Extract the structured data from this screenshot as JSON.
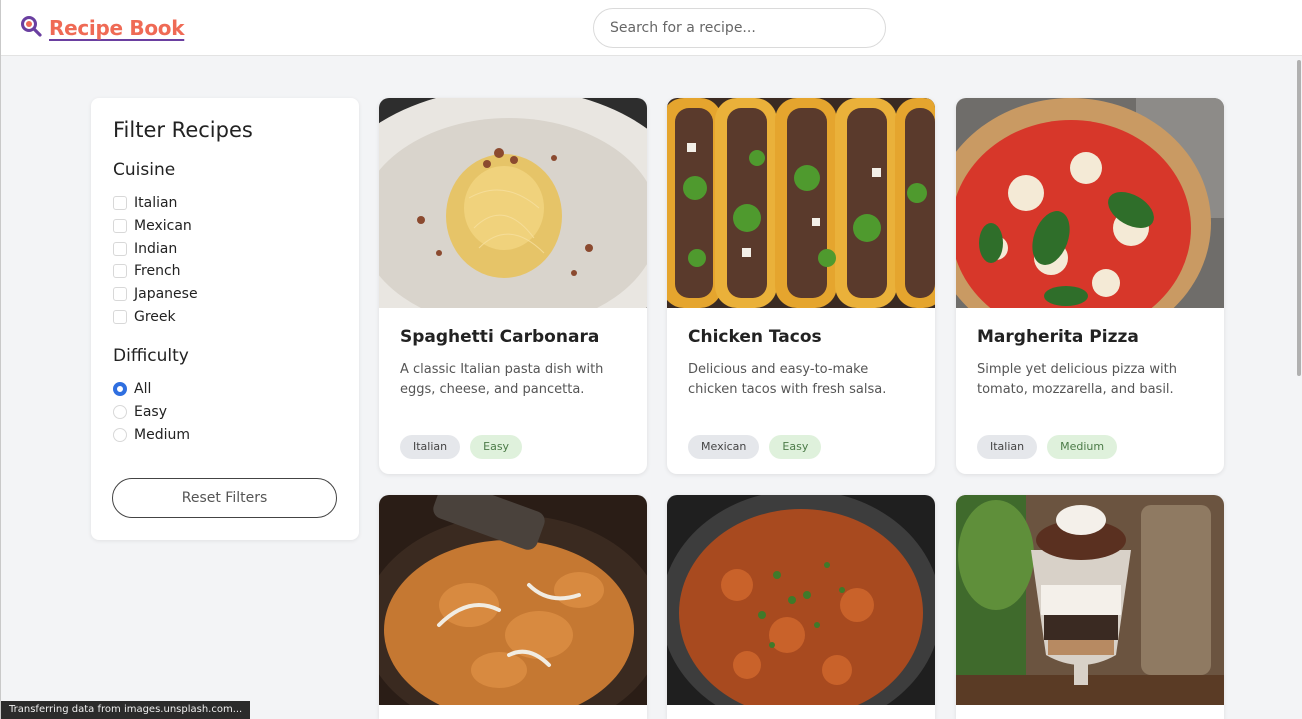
{
  "header": {
    "logo_text": "Recipe Book",
    "logo_icon": "magnifier-icon",
    "search_placeholder": "Search for a recipe..."
  },
  "sidebar": {
    "title": "Filter Recipes",
    "cuisine_heading": "Cuisine",
    "cuisines": [
      "Italian",
      "Mexican",
      "Indian",
      "French",
      "Japanese",
      "Greek"
    ],
    "difficulty_heading": "Difficulty",
    "difficulties": [
      "All",
      "Easy",
      "Medium"
    ],
    "selected_difficulty": "All",
    "reset_label": "Reset Filters"
  },
  "recipes": [
    {
      "title": "Spaghetti Carbonara",
      "description": "A classic Italian pasta dish with eggs, cheese, and pancetta.",
      "cuisine": "Italian",
      "difficulty": "Easy"
    },
    {
      "title": "Chicken Tacos",
      "description": "Delicious and easy-to-make chicken tacos with fresh salsa.",
      "cuisine": "Mexican",
      "difficulty": "Easy"
    },
    {
      "title": "Margherita Pizza",
      "description": "Simple yet delicious pizza with tomato, mozzarella, and basil.",
      "cuisine": "Italian",
      "difficulty": "Medium"
    }
  ],
  "status_text": "Transferring data from images.unsplash.com...",
  "colors": {
    "brand": "#ef6a55",
    "accent": "#2f6fe0",
    "difficulty_tag": "#dff1dc"
  }
}
